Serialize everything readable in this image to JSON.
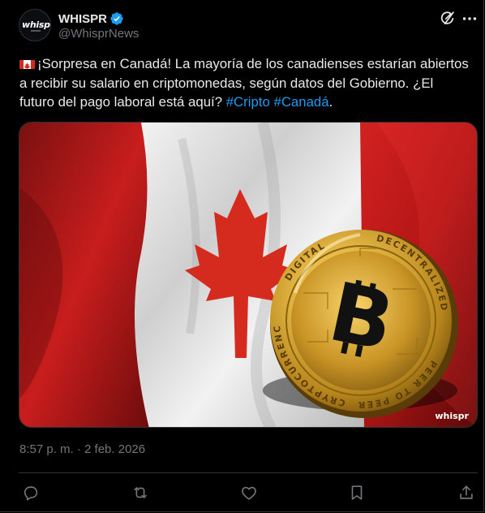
{
  "account": {
    "avatar_word": "whisp",
    "avatar_word_accent": "r",
    "display_name": "WHISPR",
    "handle": "@WhisprNews",
    "verified": true
  },
  "icons": {
    "verified": "verified-badge-icon",
    "grok": "grok-icon",
    "more": "more-icon",
    "flag": "canada-flag-icon",
    "reply": "reply-icon",
    "repost": "repost-icon",
    "like": "like-icon",
    "bookmark": "bookmark-icon",
    "share": "share-icon"
  },
  "tweet": {
    "text_main": "¡Sorpresa en Canadá! La mayoría de los canadienses estarían abiertos a recibir su salario en criptomonedas, según datos del Gobierno. ¿El futuro del pago laboral está aquí? ",
    "hashtag_1": "#Cripto",
    "hashtag_2": "#Canadá",
    "text_end": "."
  },
  "media": {
    "watermark": "whispr",
    "coin_text_top": "DECENTRALIZED",
    "coin_text_right": "PEER TO PEER",
    "coin_text_bottom": "CRYPTOCURRENCY",
    "coin_text_left": "DIGITAL"
  },
  "meta": {
    "timestamp": "8:57 p. m. · 2 feb. 2026"
  },
  "colors": {
    "background": "#000000",
    "text": "#e7e9ea",
    "muted": "#71767b",
    "link": "#1d9bf0",
    "border": "#2f3336",
    "flag_red": "#d52b1e",
    "coin_gold": "#d4a52c"
  }
}
